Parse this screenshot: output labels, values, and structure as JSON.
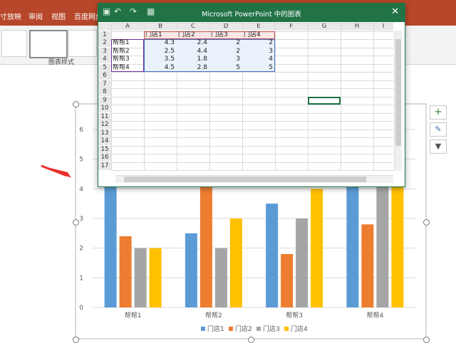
{
  "ribbon": {
    "tabs": [
      "寸放映",
      "审阅",
      "视图",
      "百度网盘"
    ],
    "group_label": "图表样式"
  },
  "excel": {
    "title": "Microsoft PowerPoint 中的图表",
    "close": "✕",
    "columns": [
      "A",
      "B",
      "C",
      "D",
      "E",
      "F",
      "G",
      "H",
      "I"
    ],
    "rows": [
      "1",
      "2",
      "3",
      "4",
      "5",
      "6",
      "7",
      "8",
      "9",
      "10",
      "11",
      "12",
      "13",
      "14",
      "15",
      "16",
      "17"
    ],
    "header_row": [
      "",
      "门店1",
      "门店2",
      "门店3",
      "门店4"
    ],
    "data_rows": [
      [
        "帮帮1",
        "4.3",
        "2.4",
        "2",
        "2"
      ],
      [
        "帮帮2",
        "2.5",
        "4.4",
        "2",
        "3"
      ],
      [
        "帮帮3",
        "3.5",
        "1.8",
        "3",
        "4"
      ],
      [
        "帮帮4",
        "4.5",
        "2.8",
        "5",
        "5"
      ]
    ]
  },
  "chart_data": {
    "type": "bar",
    "categories": [
      "帮帮1",
      "帮帮2",
      "帮帮3",
      "帮帮4"
    ],
    "series": [
      {
        "name": "门店1",
        "values": [
          4.3,
          2.5,
          3.5,
          4.5
        ],
        "color": "#5b9bd5"
      },
      {
        "name": "门店2",
        "values": [
          2.4,
          4.4,
          1.8,
          2.8
        ],
        "color": "#ed7d31"
      },
      {
        "name": "门店3",
        "values": [
          2,
          2,
          3,
          5
        ],
        "color": "#a5a5a5"
      },
      {
        "name": "门店4",
        "values": [
          2,
          3,
          4,
          5
        ],
        "color": "#ffc000"
      }
    ],
    "ylim": [
      0,
      6
    ],
    "yticks": [
      "0",
      "1",
      "2",
      "3",
      "4",
      "5",
      "6"
    ],
    "grid": true,
    "legend": "bottom"
  },
  "side_buttons": [
    "plus-icon",
    "brush-icon",
    "filter-icon"
  ],
  "colors": {
    "excel_green": "#217346",
    "annotation": "#e8312f",
    "ribbon": "#b7472a"
  }
}
